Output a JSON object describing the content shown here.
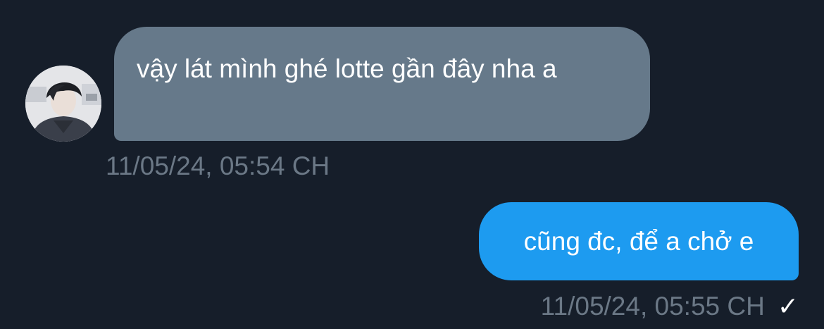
{
  "conversation": {
    "incoming": {
      "avatar": "avatar-photo",
      "text": "vậy lát mình ghé lotte gần đây nha a",
      "time": "11/05/24, 05:54 CH"
    },
    "outgoing": {
      "text": "cũng đc, để a chở e",
      "time": "11/05/24, 05:55 CH",
      "status_icon": "check-icon"
    }
  },
  "colors": {
    "background": "#161e2a",
    "incoming_bubble": "#66798a",
    "outgoing_bubble": "#1d9bf0",
    "timestamp": "#6b7886"
  }
}
